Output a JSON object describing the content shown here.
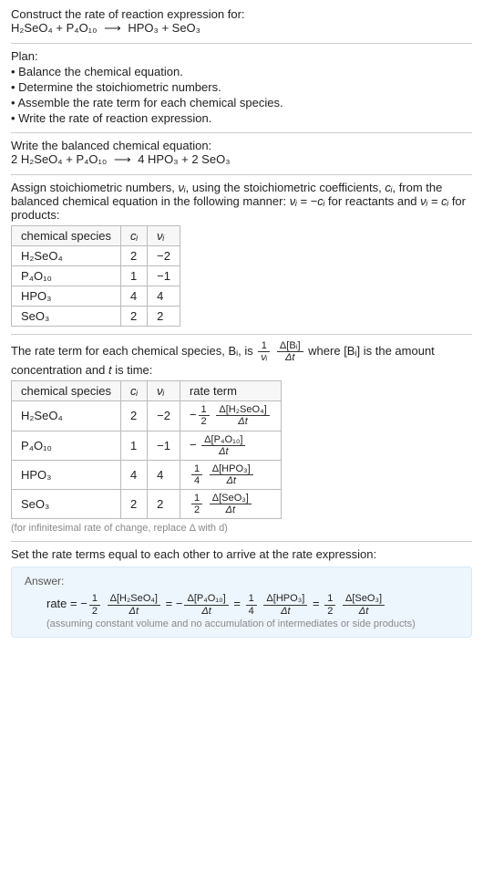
{
  "intro": {
    "title": "Construct the rate of reaction expression for:",
    "equation_lhs1": "H₂SeO₄",
    "plus": " + ",
    "equation_lhs2": "P₄O₁₀",
    "arrow": "⟶",
    "equation_rhs1": "HPO₃",
    "equation_rhs2": "SeO₃"
  },
  "plan": {
    "title": "Plan:",
    "items": [
      "• Balance the chemical equation.",
      "• Determine the stoichiometric numbers.",
      "• Assemble the rate term for each chemical species.",
      "• Write the rate of reaction expression."
    ]
  },
  "balanced": {
    "title": "Write the balanced chemical equation:",
    "c1": "2 H₂SeO₄",
    "c2": "P₄O₁₀",
    "c3": "4 HPO₃",
    "c4": "2 SeO₃",
    "plus": " + ",
    "arrow": "⟶"
  },
  "assign": {
    "text1": "Assign stoichiometric numbers, ",
    "nu_i": "νᵢ",
    "text2": ", using the stoichiometric coefficients, ",
    "c_i": "cᵢ",
    "text3": ", from the balanced chemical equation in the following manner: ",
    "eq_reactants": "νᵢ = −cᵢ",
    "text4": " for reactants and ",
    "eq_products": "νᵢ = cᵢ",
    "text5": " for products:"
  },
  "table1": {
    "h1": "chemical species",
    "h2": "cᵢ",
    "h3": "νᵢ",
    "rows": [
      {
        "sp": "H₂SeO₄",
        "ci": "2",
        "vi": "−2"
      },
      {
        "sp": "P₄O₁₀",
        "ci": "1",
        "vi": "−1"
      },
      {
        "sp": "HPO₃",
        "ci": "4",
        "vi": "4"
      },
      {
        "sp": "SeO₃",
        "ci": "2",
        "vi": "2"
      }
    ]
  },
  "rateterm": {
    "text1": "The rate term for each chemical species, ",
    "Bi": "Bᵢ",
    "text2": ", is ",
    "frac1_num": "1",
    "frac1_den": "νᵢ",
    "frac2_num": "Δ[Bᵢ]",
    "frac2_den": "Δt",
    "text3": " where [Bᵢ] is the amount concentration and ",
    "t": "t",
    "text4": " is time:"
  },
  "table2": {
    "h1": "chemical species",
    "h2": "cᵢ",
    "h3": "νᵢ",
    "h4": "rate term",
    "rows": [
      {
        "sp": "H₂SeO₄",
        "ci": "2",
        "vi": "−2",
        "sign": "−",
        "f1n": "1",
        "f1d": "2",
        "f2n": "Δ[H₂SeO₄]",
        "f2d": "Δt"
      },
      {
        "sp": "P₄O₁₀",
        "ci": "1",
        "vi": "−1",
        "sign": "−",
        "f1n": "",
        "f1d": "",
        "f2n": "Δ[P₄O₁₀]",
        "f2d": "Δt"
      },
      {
        "sp": "HPO₃",
        "ci": "4",
        "vi": "4",
        "sign": "",
        "f1n": "1",
        "f1d": "4",
        "f2n": "Δ[HPO₃]",
        "f2d": "Δt"
      },
      {
        "sp": "SeO₃",
        "ci": "2",
        "vi": "2",
        "sign": "",
        "f1n": "1",
        "f1d": "2",
        "f2n": "Δ[SeO₃]",
        "f2d": "Δt"
      }
    ]
  },
  "note": "(for infinitesimal rate of change, replace Δ with d)",
  "finaltext": "Set the rate terms equal to each other to arrive at the rate expression:",
  "answer": {
    "label": "Answer:",
    "rate": "rate = ",
    "neg": "−",
    "f1n": "1",
    "f1d": "2",
    "t1n": "Δ[H₂SeO₄]",
    "t1d": "Δt",
    "eq": " = ",
    "t2n": "Δ[P₄O₁₀]",
    "t2d": "Δt",
    "f3n": "1",
    "f3d": "4",
    "t3n": "Δ[HPO₃]",
    "t3d": "Δt",
    "f4n": "1",
    "f4d": "2",
    "t4n": "Δ[SeO₃]",
    "t4d": "Δt",
    "note": "(assuming constant volume and no accumulation of intermediates or side products)"
  }
}
